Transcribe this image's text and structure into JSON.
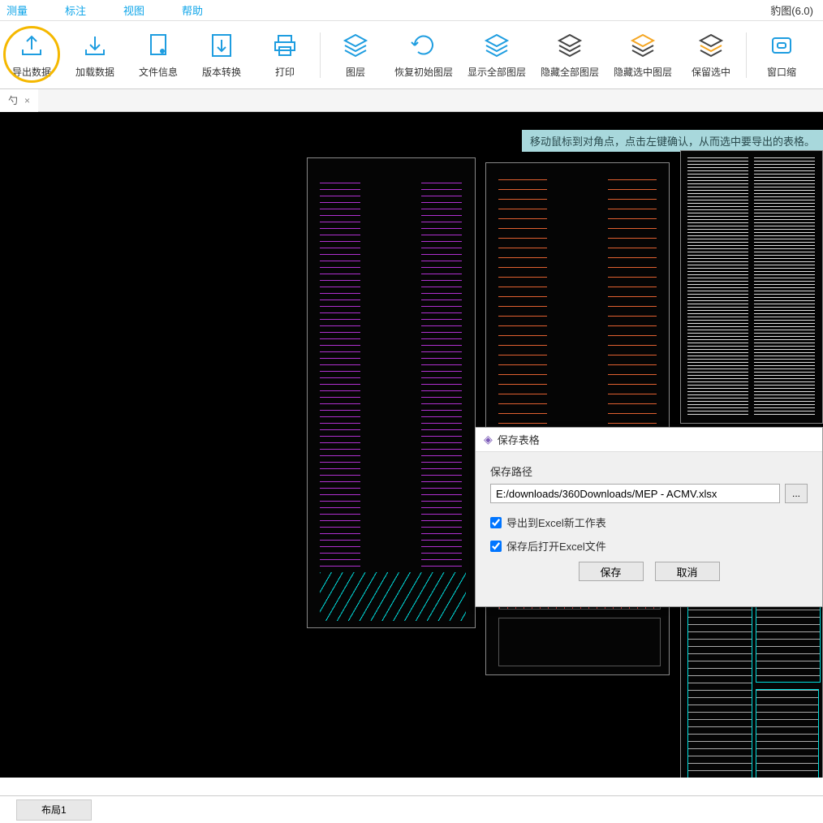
{
  "app": {
    "title": "豹图(6.0)"
  },
  "menubar": {
    "items": [
      "测量",
      "标注",
      "视图",
      "帮助"
    ]
  },
  "toolbar": {
    "items": [
      {
        "label": "导出数据",
        "icon": "export",
        "highlight": true
      },
      {
        "label": "加载数据",
        "icon": "import"
      },
      {
        "label": "文件信息",
        "icon": "fileinfo"
      },
      {
        "label": "版本转换",
        "icon": "convert"
      },
      {
        "label": "打印",
        "icon": "print"
      },
      {
        "sep": true
      },
      {
        "label": "图层",
        "icon": "layers-blue"
      },
      {
        "label": "恢复初始图层",
        "icon": "restore"
      },
      {
        "label": "显示全部图层",
        "icon": "showall"
      },
      {
        "label": "隐藏全部图层",
        "icon": "hideall"
      },
      {
        "label": "隐藏选中图层",
        "icon": "hidesel"
      },
      {
        "label": "保留选中",
        "icon": "keepsel"
      },
      {
        "sep": true
      },
      {
        "label": "窗口缩",
        "icon": "zoomwin"
      }
    ]
  },
  "tabs": {
    "active": "勺",
    "close": "×"
  },
  "hint": "移动鼠标到对角点，点击左键确认，从而选中要导出的表格。",
  "dialog": {
    "title": "保存表格",
    "path_label": "保存路径",
    "path_value": "E:/downloads/360Downloads/MEP - ACMV.xlsx",
    "browse": "...",
    "check1": "导出到Excel新工作表",
    "check2": "保存后打开Excel文件",
    "save": "保存",
    "cancel": "取消"
  },
  "bottom": {
    "tab": "布局1"
  }
}
